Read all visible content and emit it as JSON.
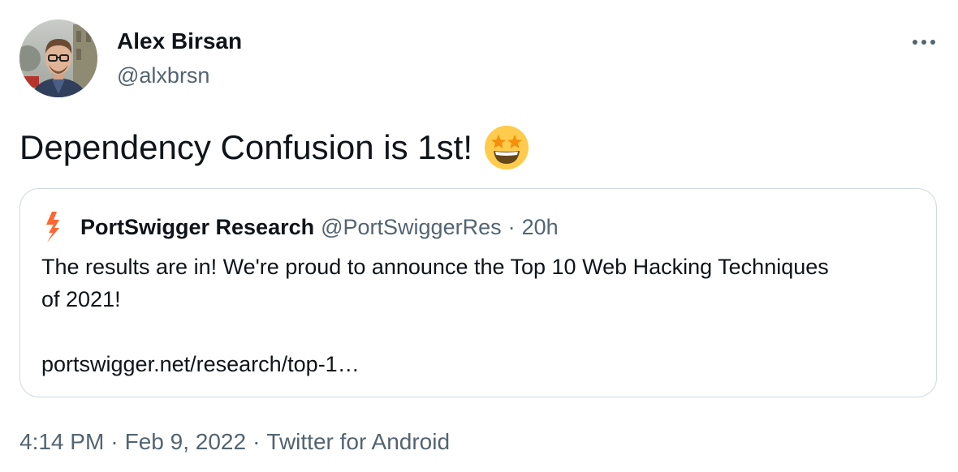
{
  "author": {
    "name": "Alex Birsan",
    "handle": "@alxbrsn"
  },
  "tweet": {
    "text": "Dependency Confusion is 1st!",
    "emoji": "star-struck-emoji"
  },
  "quoted": {
    "name": "PortSwigger Research",
    "handle": "@PortSwiggerRes",
    "separator": "·",
    "time": "20h",
    "line1": "The results are in! We're proud to announce the Top 10 Web Hacking Techniques",
    "line2": "of 2021!",
    "link": "portswigger.net/research/top-1…",
    "logo_icon": "portswigger-bolt-icon",
    "logo_color": "#ff6633"
  },
  "meta": {
    "time": "4:14 PM",
    "separator": "·",
    "date": "Feb 9, 2022",
    "source": "Twitter for Android"
  },
  "icons": {
    "more": "more-horizontal-icon"
  },
  "colors": {
    "text_primary": "#0f1419",
    "text_secondary": "#536471",
    "border": "#cfd9de"
  }
}
